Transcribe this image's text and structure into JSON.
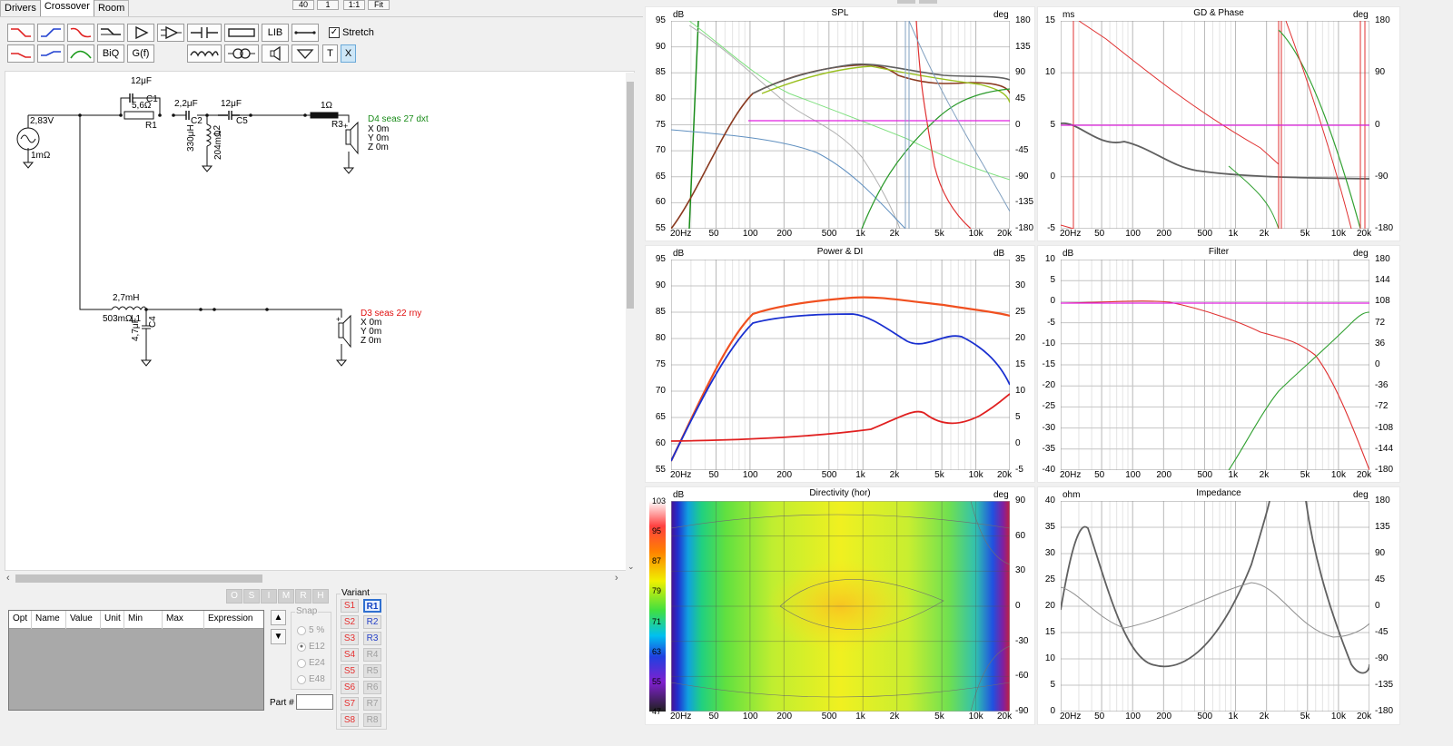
{
  "tabs": [
    "Drivers",
    "Crossover",
    "Room"
  ],
  "active_tab": "Crossover",
  "top_buttons": [
    "40",
    "1",
    "1:1",
    "Fit"
  ],
  "toolbar": {
    "lib_label": "LIB",
    "biq_label": "BiQ",
    "gf_label": "G(f)",
    "t_label": "T",
    "x_label": "X",
    "stretch_label": "Stretch",
    "stretch_checked": "✓"
  },
  "schematic": {
    "source_voltage": "2,83V",
    "source_resistance": "1mΩ",
    "c1": "12μF",
    "c1_name": "C1",
    "r1": "5,6Ω",
    "r1_name": "R1",
    "c2": "2,2μF",
    "c2_name": "C2",
    "l2": "330μH",
    "l2_name": "L2",
    "l2_res": "204mΩ",
    "c5": "12μF",
    "c5_name": "C5",
    "r3": "1Ω",
    "r3_name": "R3",
    "d4_name": "D4 seas 27 dxt",
    "d4_x": "X 0m",
    "d4_y": "Y 0m",
    "d4_z": "Z 0m",
    "l1": "2,7mH",
    "l1_res": "503mΩ",
    "l1_name": "L1",
    "c4": "4,7μF",
    "c4_name": "C4",
    "d3_name": "D3 seas 22 rny",
    "d3_x": "X 0m",
    "d3_y": "Y 0m",
    "d3_z": "Z 0m",
    "color_d4": "#1a8c1a",
    "color_d3": "#e01010"
  },
  "opt_buttons": [
    "O",
    "S",
    "I",
    "M",
    "R",
    "H"
  ],
  "opt_table": {
    "columns": [
      "Opt",
      "Name",
      "Value",
      "Unit",
      "Min",
      "Max",
      "Expression"
    ]
  },
  "snap": {
    "title": "Snap",
    "options": [
      "5 %",
      "E12",
      "E24",
      "E48"
    ],
    "selected": "E12"
  },
  "part_label": "Part #",
  "variant": {
    "title": "Variant",
    "s": [
      "S1",
      "S2",
      "S3",
      "S4",
      "S5",
      "S6",
      "S7",
      "S8"
    ],
    "r": [
      "R1",
      "R2",
      "R3",
      "R4",
      "R5",
      "R6",
      "R7",
      "R8"
    ],
    "selected": "R1"
  },
  "freq_ticks": [
    "20Hz",
    "50",
    "100",
    "200",
    "500",
    "1k",
    "2k",
    "5k",
    "10k",
    "20k"
  ],
  "panels": {
    "spl": {
      "title": "SPL",
      "unit_left": "dB",
      "unit_right": "deg",
      "y_left": [
        "95",
        "90",
        "85",
        "80",
        "75",
        "70",
        "65",
        "60",
        "55"
      ],
      "y_right": [
        "180",
        "135",
        "90",
        "45",
        "0",
        "-45",
        "-90",
        "-135",
        "-180"
      ]
    },
    "gd": {
      "title": "GD & Phase",
      "unit_left": "ms",
      "unit_right": "deg",
      "y_left": [
        "15",
        "10",
        "5",
        "0",
        "-5"
      ],
      "y_right": [
        "180",
        "90",
        "0",
        "-90",
        "-180"
      ]
    },
    "power": {
      "title": "Power & DI",
      "unit_left": "dB",
      "unit_right": "dB",
      "y_left": [
        "95",
        "90",
        "85",
        "80",
        "75",
        "70",
        "65",
        "60",
        "55"
      ],
      "y_right": [
        "35",
        "30",
        "25",
        "20",
        "15",
        "10",
        "5",
        "0",
        "-5"
      ]
    },
    "filter": {
      "title": "Filter",
      "unit_left": "dB",
      "unit_right": "deg",
      "y_left": [
        "10",
        "5",
        "0",
        "-5",
        "-10",
        "-15",
        "-20",
        "-25",
        "-30",
        "-35",
        "-40"
      ],
      "y_right": [
        "180",
        "144",
        "108",
        "72",
        "36",
        "0",
        "-36",
        "-72",
        "-108",
        "-144",
        "-180"
      ]
    },
    "directivity": {
      "title": "Directivity (hor)",
      "unit_left": "dB",
      "unit_right": "deg",
      "scale": [
        "103",
        "95",
        "87",
        "79",
        "71",
        "63",
        "55",
        "47"
      ],
      "y_right": [
        "90",
        "60",
        "30",
        "0",
        "-30",
        "-60",
        "-90"
      ]
    },
    "impedance": {
      "title": "Impedance",
      "unit_left": "ohm",
      "unit_right": "deg",
      "y_left": [
        "40",
        "35",
        "30",
        "25",
        "20",
        "15",
        "10",
        "5",
        "0"
      ],
      "y_right": [
        "180",
        "135",
        "90",
        "45",
        "0",
        "-45",
        "-90",
        "-135",
        "-180"
      ]
    }
  }
}
